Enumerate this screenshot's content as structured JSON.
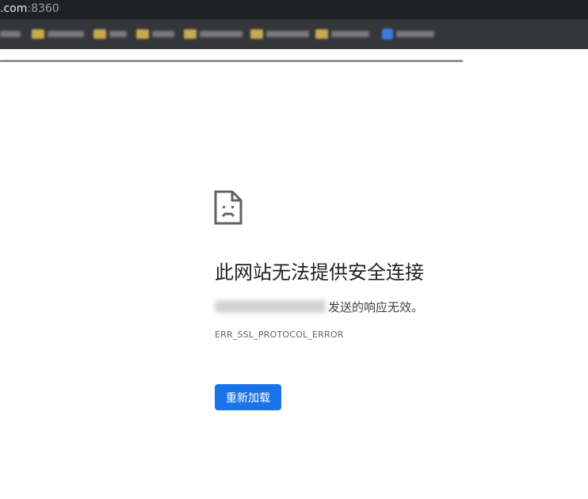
{
  "browser": {
    "url_domain": ".com",
    "url_port": ":8360",
    "bookmark_colors": {
      "folder": "#c9a94e",
      "favicon": "#3b7ddd"
    }
  },
  "error_page": {
    "icon": "sad-page-icon",
    "heading": "此网站无法提供安全连接",
    "description_suffix": "发送的响应无效。",
    "error_code": "ERR_SSL_PROTOCOL_ERROR",
    "reload_label": "重新加载",
    "accent_color": "#1a73e8"
  }
}
